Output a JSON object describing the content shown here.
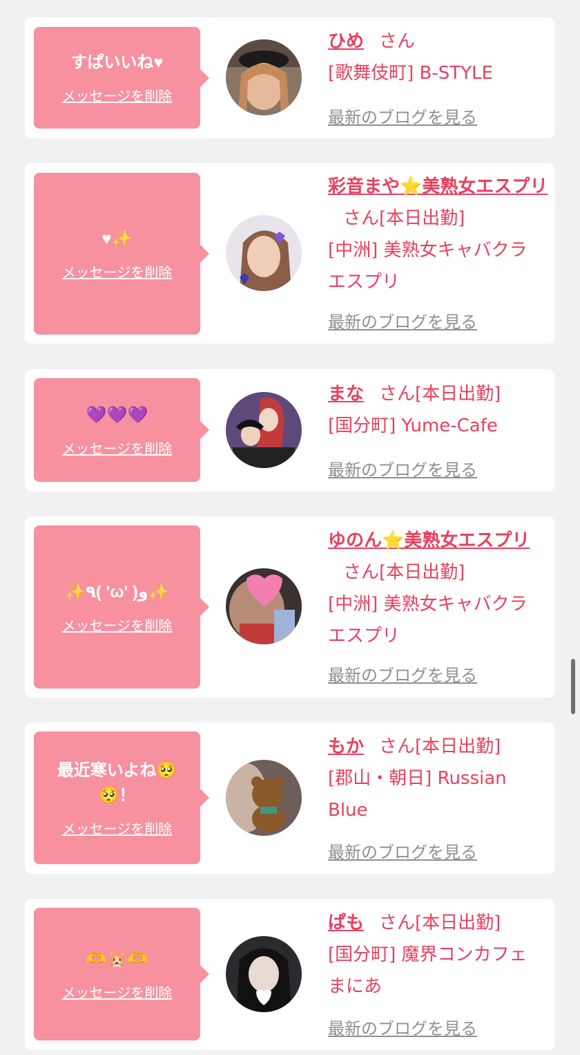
{
  "delete_label": "メッセージを削除",
  "blog_label": "最新のブログを見る",
  "honorific": "さん",
  "cards": [
    {
      "message": "すぱいいね♥",
      "name": "ひめ",
      "status": "",
      "area_shop": "[歌舞伎町] B-STYLE"
    },
    {
      "message": "♥✨",
      "name": "彩音まや⭐美熟女エスプリ",
      "status": "[本日出勤]",
      "area_shop": "[中洲] 美熟女キャバクラ エスプリ"
    },
    {
      "message": "💜💜💜",
      "name": "まな",
      "status": "[本日出勤]",
      "area_shop": "[国分町] Yume-Cafe"
    },
    {
      "message": "✨٩( 'ω' )و✨",
      "name": "ゆのん⭐美熟女エスプリ",
      "status": "[本日出勤]",
      "area_shop": "[中洲] 美熟女キャバクラ エスプリ"
    },
    {
      "message": "最近寒いよね🥺🥺！",
      "name": "もか",
      "status": "[本日出勤]",
      "area_shop": "[郡山・朝日] Russian Blue"
    },
    {
      "message": "🫶🐹🫶",
      "name": "ぱも",
      "status": "[本日出勤]",
      "area_shop": "[国分町] 魔界コンカフェ まにあ"
    }
  ]
}
